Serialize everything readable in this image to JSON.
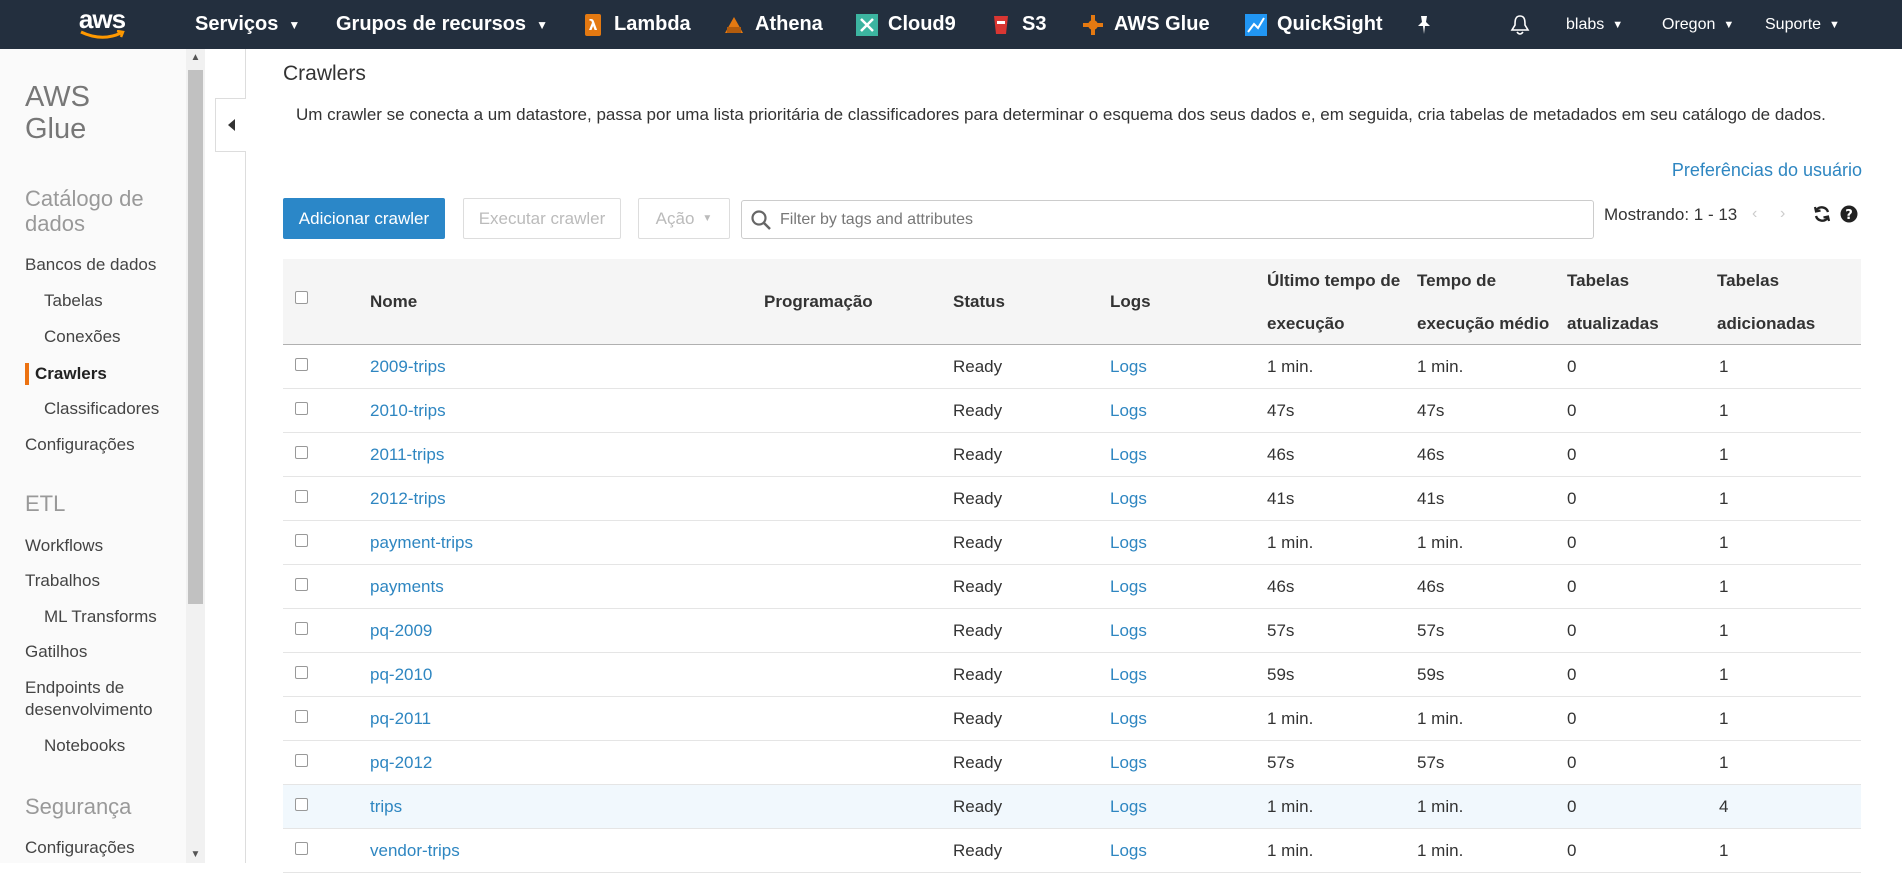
{
  "topnav": {
    "services": "Serviços",
    "resource_groups": "Grupos de recursos",
    "shortcuts": [
      {
        "label": "Lambda",
        "icon": "lambda-icon",
        "color": "#e47911"
      },
      {
        "label": "Athena",
        "icon": "athena-icon",
        "color": "#e47911"
      },
      {
        "label": "Cloud9",
        "icon": "cloud9-icon",
        "color": "#3cb4a0"
      },
      {
        "label": "S3",
        "icon": "s3-icon",
        "color": "#d93632"
      },
      {
        "label": "AWS Glue",
        "icon": "glue-icon",
        "color": "#e47911"
      },
      {
        "label": "QuickSight",
        "icon": "quicksight-icon",
        "color": "#2196f3"
      }
    ],
    "account": "blabs",
    "region": "Oregon",
    "support": "Suporte"
  },
  "sidebar": {
    "title_line1": "AWS",
    "title_line2": "Glue",
    "catalog_line1": "Catálogo de",
    "catalog_line2": "dados",
    "databases": "Bancos de dados",
    "tables": "Tabelas",
    "connections": "Conexões",
    "crawlers": "Crawlers",
    "classifiers": "Classificadores",
    "settings": "Configurações",
    "etl": "ETL",
    "workflows": "Workflows",
    "jobs": "Trabalhos",
    "ml_transforms": "ML Transforms",
    "triggers": "Gatilhos",
    "dev_endpoints_line1": "Endpoints de",
    "dev_endpoints_line2": "desenvolvimento",
    "notebooks": "Notebooks",
    "security": "Segurança",
    "security_settings": "Configurações"
  },
  "main": {
    "title": "Crawlers",
    "description": "Um crawler se conecta a um datastore, passa por uma lista prioritária de classificadores para determinar o esquema dos seus dados e, em seguida, cria tabelas de metadados em seu catálogo de dados.",
    "user_prefs": "Preferências do usuário",
    "add_crawler": "Adicionar crawler",
    "run_crawler": "Executar crawler",
    "action": "Ação",
    "search_placeholder": "Filter by tags and attributes",
    "showing": "Mostrando: 1 - 13"
  },
  "table": {
    "headers": {
      "name": "Nome",
      "schedule": "Programação",
      "status": "Status",
      "logs": "Logs",
      "last_runtime_1": "Último tempo de",
      "last_runtime_2": "execução",
      "median_runtime_1": "Tempo de",
      "median_runtime_2": "execução médio",
      "tables_updated_1": "Tabelas",
      "tables_updated_2": "atualizadas",
      "tables_added_1": "Tabelas",
      "tables_added_2": "adicionadas"
    },
    "rows": [
      {
        "name": "2009-trips",
        "schedule": "",
        "status": "Ready",
        "logs": "Logs",
        "last": "1 min.",
        "median": "1 min.",
        "updated": "0",
        "added": "1"
      },
      {
        "name": "2010-trips",
        "schedule": "",
        "status": "Ready",
        "logs": "Logs",
        "last": "47s",
        "median": "47s",
        "updated": "0",
        "added": "1"
      },
      {
        "name": "2011-trips",
        "schedule": "",
        "status": "Ready",
        "logs": "Logs",
        "last": "46s",
        "median": "46s",
        "updated": "0",
        "added": "1"
      },
      {
        "name": "2012-trips",
        "schedule": "",
        "status": "Ready",
        "logs": "Logs",
        "last": "41s",
        "median": "41s",
        "updated": "0",
        "added": "1"
      },
      {
        "name": "payment-trips",
        "schedule": "",
        "status": "Ready",
        "logs": "Logs",
        "last": "1 min.",
        "median": "1 min.",
        "updated": "0",
        "added": "1"
      },
      {
        "name": "payments",
        "schedule": "",
        "status": "Ready",
        "logs": "Logs",
        "last": "46s",
        "median": "46s",
        "updated": "0",
        "added": "1"
      },
      {
        "name": "pq-2009",
        "schedule": "",
        "status": "Ready",
        "logs": "Logs",
        "last": "57s",
        "median": "57s",
        "updated": "0",
        "added": "1"
      },
      {
        "name": "pq-2010",
        "schedule": "",
        "status": "Ready",
        "logs": "Logs",
        "last": "59s",
        "median": "59s",
        "updated": "0",
        "added": "1"
      },
      {
        "name": "pq-2011",
        "schedule": "",
        "status": "Ready",
        "logs": "Logs",
        "last": "1 min.",
        "median": "1 min.",
        "updated": "0",
        "added": "1"
      },
      {
        "name": "pq-2012",
        "schedule": "",
        "status": "Ready",
        "logs": "Logs",
        "last": "57s",
        "median": "57s",
        "updated": "0",
        "added": "1"
      },
      {
        "name": "trips",
        "schedule": "",
        "status": "Ready",
        "logs": "Logs",
        "last": "1 min.",
        "median": "1 min.",
        "updated": "0",
        "added": "4"
      },
      {
        "name": "vendor-trips",
        "schedule": "",
        "status": "Ready",
        "logs": "Logs",
        "last": "1 min.",
        "median": "1 min.",
        "updated": "0",
        "added": "1"
      }
    ]
  }
}
